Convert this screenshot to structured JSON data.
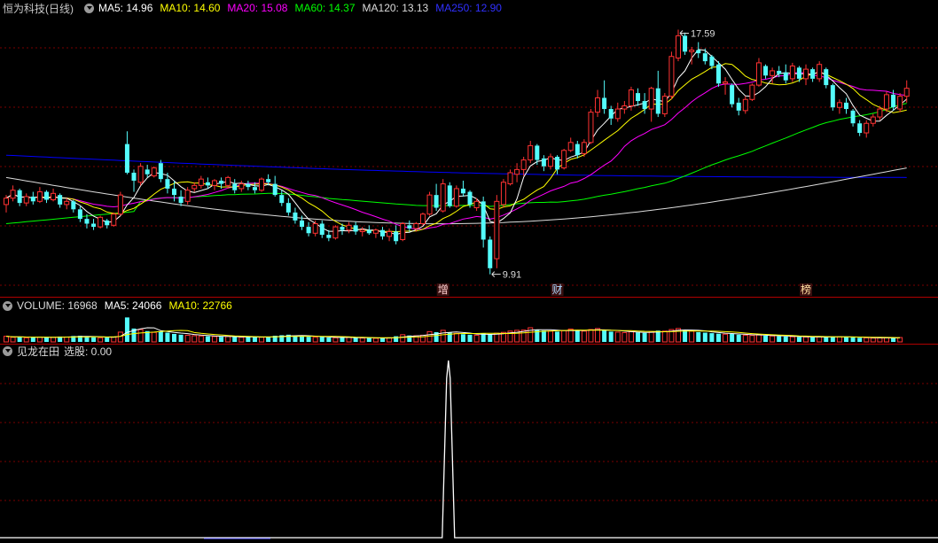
{
  "colors": {
    "up": "#ff3232",
    "down": "#54fcfc",
    "ma5": "#ffffff",
    "ma10": "#ffff00",
    "ma20": "#ff00ff",
    "ma60": "#00ff00",
    "ma120": "#dcdcdc",
    "ma250": "#0000ff",
    "grid": "#7a0000",
    "signal": "#ffffff"
  },
  "price_panel": {
    "title": "恒为科技(日线)",
    "ma5_label": "MA5: 14.96",
    "ma10_label": "MA10: 14.60",
    "ma20_label": "MA20: 15.08",
    "ma60_label": "MA60: 14.37",
    "ma120_label": "MA120: 13.13",
    "ma250_label": "MA250: 12.90",
    "high_label": "17.59",
    "low_label": "9.91",
    "markers": [
      {
        "text": "增",
        "index": 65
      },
      {
        "text": "财",
        "index": 82
      },
      {
        "text": "榜",
        "index": 119
      }
    ]
  },
  "volume_panel": {
    "volume_label": "VOLUME: 16968",
    "ma5_label": "MA5: 24066",
    "ma10_label": "MA10: 22766"
  },
  "signal_panel": {
    "title": "见龙在田",
    "value_label": "选股: 0.00"
  },
  "chart_data": [
    {
      "type": "candlestick",
      "title": "恒为科技(日线)",
      "y_range": [
        9.4,
        18.3
      ],
      "high_point": {
        "index": 100,
        "value": 17.59
      },
      "low_point": {
        "index": 72,
        "value": 9.91
      },
      "candles": [
        [
          12.1,
          12.4,
          11.85,
          12.3
        ],
        [
          12.3,
          12.7,
          12.2,
          12.55
        ],
        [
          12.55,
          12.6,
          12.05,
          12.15
        ],
        [
          12.15,
          12.45,
          12.05,
          12.35
        ],
        [
          12.35,
          12.5,
          12.1,
          12.2
        ],
        [
          12.2,
          12.65,
          12.15,
          12.5
        ],
        [
          12.5,
          12.55,
          12.15,
          12.25
        ],
        [
          12.25,
          12.6,
          12.2,
          12.45
        ],
        [
          12.4,
          12.45,
          12.0,
          12.1
        ],
        [
          12.1,
          12.3,
          11.95,
          12.2
        ],
        [
          12.2,
          12.25,
          11.85,
          11.95
        ],
        [
          11.95,
          12.05,
          11.55,
          11.65
        ],
        [
          11.65,
          11.8,
          11.35,
          11.5
        ],
        [
          11.5,
          11.65,
          11.3,
          11.4
        ],
        [
          11.4,
          11.75,
          11.35,
          11.7
        ],
        [
          11.6,
          11.65,
          11.35,
          11.45
        ],
        [
          11.45,
          11.85,
          11.4,
          11.8
        ],
        [
          11.8,
          12.5,
          11.75,
          12.4
        ],
        [
          14.0,
          14.4,
          13.05,
          13.1
        ],
        [
          13.1,
          13.2,
          12.5,
          12.85
        ],
        [
          12.8,
          13.4,
          12.7,
          13.3
        ],
        [
          13.2,
          13.35,
          12.95,
          13.05
        ],
        [
          13.0,
          13.3,
          12.95,
          13.25
        ],
        [
          13.4,
          13.5,
          12.8,
          12.9
        ],
        [
          12.9,
          13.1,
          12.45,
          12.6
        ],
        [
          12.6,
          12.85,
          12.2,
          12.4
        ],
        [
          12.35,
          12.55,
          12.05,
          12.15
        ],
        [
          12.2,
          12.65,
          12.1,
          12.55
        ],
        [
          12.6,
          12.8,
          12.5,
          12.7
        ],
        [
          12.7,
          13.0,
          12.6,
          12.9
        ],
        [
          12.8,
          12.95,
          12.6,
          12.7
        ],
        [
          12.7,
          12.9,
          12.55,
          12.85
        ],
        [
          12.85,
          12.95,
          12.6,
          12.75
        ],
        [
          12.7,
          13.0,
          12.6,
          12.95
        ],
        [
          12.75,
          12.9,
          12.45,
          12.55
        ],
        [
          12.6,
          12.85,
          12.5,
          12.75
        ],
        [
          12.75,
          12.85,
          12.55,
          12.65
        ],
        [
          12.65,
          12.8,
          12.45,
          12.55
        ],
        [
          12.55,
          12.95,
          12.5,
          12.9
        ],
        [
          12.9,
          13.05,
          12.7,
          12.8
        ],
        [
          12.75,
          13.0,
          12.35,
          12.4
        ],
        [
          12.4,
          12.55,
          12.05,
          12.15
        ],
        [
          12.15,
          12.3,
          11.75,
          11.85
        ],
        [
          11.85,
          12.0,
          11.5,
          11.6
        ],
        [
          11.6,
          11.75,
          11.3,
          11.4
        ],
        [
          11.4,
          11.55,
          11.1,
          11.2
        ],
        [
          11.2,
          11.6,
          11.1,
          11.5
        ],
        [
          11.5,
          11.6,
          11.05,
          11.15
        ],
        [
          11.15,
          11.3,
          10.95,
          11.05
        ],
        [
          11.05,
          11.45,
          11.0,
          11.4
        ],
        [
          11.4,
          11.5,
          11.15,
          11.3
        ],
        [
          11.3,
          11.55,
          11.2,
          11.45
        ],
        [
          11.45,
          11.55,
          11.15,
          11.25
        ],
        [
          11.25,
          11.4,
          11.1,
          11.3
        ],
        [
          11.3,
          11.45,
          11.15,
          11.2
        ],
        [
          11.2,
          11.35,
          11.05,
          11.3
        ],
        [
          11.3,
          11.4,
          11.0,
          11.1
        ],
        [
          11.1,
          11.35,
          10.95,
          11.25
        ],
        [
          11.25,
          11.45,
          10.85,
          10.95
        ],
        [
          11.0,
          11.55,
          10.95,
          11.5
        ],
        [
          11.45,
          11.6,
          11.25,
          11.35
        ],
        [
          11.35,
          11.55,
          11.25,
          11.5
        ],
        [
          11.5,
          11.85,
          11.45,
          11.8
        ],
        [
          11.8,
          12.5,
          11.75,
          12.4
        ],
        [
          12.4,
          12.75,
          11.9,
          12.0
        ],
        [
          11.9,
          12.9,
          11.85,
          12.75
        ],
        [
          12.7,
          12.8,
          12.0,
          12.05
        ],
        [
          12.05,
          12.7,
          12.0,
          12.6
        ],
        [
          12.6,
          12.85,
          12.35,
          12.45
        ],
        [
          12.5,
          12.55,
          12.0,
          12.1
        ],
        [
          12.0,
          12.3,
          11.9,
          12.2
        ],
        [
          12.2,
          12.35,
          10.75,
          11.0
        ],
        [
          11.0,
          11.1,
          9.91,
          10.1
        ],
        [
          10.4,
          12.4,
          10.1,
          12.2
        ],
        [
          12.1,
          12.9,
          12.0,
          12.8
        ],
        [
          12.75,
          13.2,
          12.7,
          13.1
        ],
        [
          13.05,
          13.4,
          12.8,
          13.2
        ],
        [
          13.2,
          13.6,
          13.0,
          13.5
        ],
        [
          13.5,
          14.1,
          13.4,
          13.95
        ],
        [
          13.95,
          14.0,
          13.35,
          13.5
        ],
        [
          13.55,
          13.65,
          13.15,
          13.3
        ],
        [
          13.3,
          13.7,
          13.2,
          13.6
        ],
        [
          13.6,
          13.65,
          13.05,
          13.2
        ],
        [
          13.25,
          13.85,
          13.2,
          13.8
        ],
        [
          13.8,
          14.2,
          13.75,
          14.05
        ],
        [
          14.0,
          14.1,
          13.55,
          13.65
        ],
        [
          13.7,
          14.15,
          13.6,
          14.05
        ],
        [
          14.05,
          15.1,
          14.0,
          15.0
        ],
        [
          15.0,
          15.7,
          14.85,
          15.45
        ],
        [
          15.45,
          16.0,
          14.95,
          15.1
        ],
        [
          15.1,
          15.2,
          14.6,
          14.8
        ],
        [
          14.8,
          15.3,
          14.7,
          15.1
        ],
        [
          15.1,
          15.35,
          14.95,
          15.2
        ],
        [
          15.2,
          15.8,
          15.05,
          15.7
        ],
        [
          15.6,
          15.75,
          15.2,
          15.35
        ],
        [
          15.35,
          15.6,
          14.95,
          15.1
        ],
        [
          15.1,
          15.8,
          14.7,
          15.75
        ],
        [
          15.75,
          16.3,
          14.85,
          14.95
        ],
        [
          14.95,
          15.6,
          14.85,
          15.5
        ],
        [
          15.5,
          16.9,
          15.4,
          16.75
        ],
        [
          16.7,
          17.59,
          16.6,
          17.4
        ],
        [
          17.4,
          17.5,
          16.8,
          16.9
        ],
        [
          16.9,
          17.05,
          16.5,
          16.95
        ],
        [
          16.95,
          17.2,
          16.7,
          16.85
        ],
        [
          16.85,
          17.0,
          16.5,
          16.6
        ],
        [
          16.75,
          16.8,
          16.35,
          16.45
        ],
        [
          16.5,
          16.6,
          15.8,
          15.9
        ],
        [
          15.9,
          16.1,
          15.55,
          15.95
        ],
        [
          15.85,
          15.9,
          15.15,
          15.25
        ],
        [
          15.3,
          15.45,
          14.9,
          15.05
        ],
        [
          15.05,
          15.5,
          14.95,
          15.4
        ],
        [
          15.4,
          15.9,
          15.35,
          15.85
        ],
        [
          15.85,
          16.7,
          15.8,
          16.55
        ],
        [
          16.45,
          16.5,
          16.05,
          16.15
        ],
        [
          16.15,
          16.4,
          15.9,
          16.3
        ],
        [
          16.3,
          16.45,
          16.1,
          16.2
        ],
        [
          16.25,
          16.5,
          15.9,
          16.0
        ],
        [
          16.05,
          16.55,
          15.95,
          16.45
        ],
        [
          16.4,
          16.45,
          15.95,
          16.05
        ],
        [
          16.05,
          16.5,
          15.85,
          16.35
        ],
        [
          16.35,
          16.4,
          15.95,
          16.05
        ],
        [
          16.05,
          16.6,
          15.95,
          16.5
        ],
        [
          16.35,
          16.4,
          15.75,
          15.85
        ],
        [
          15.85,
          15.9,
          15.05,
          15.15
        ],
        [
          15.15,
          15.4,
          14.95,
          15.3
        ],
        [
          15.3,
          15.45,
          14.95,
          15.1
        ],
        [
          15.05,
          15.1,
          14.55,
          14.65
        ],
        [
          14.65,
          14.75,
          14.25,
          14.35
        ],
        [
          14.35,
          14.75,
          14.2,
          14.65
        ],
        [
          14.65,
          14.95,
          14.55,
          14.85
        ],
        [
          14.85,
          15.2,
          14.75,
          15.1
        ],
        [
          15.1,
          15.65,
          15.0,
          15.55
        ],
        [
          15.55,
          15.7,
          15.05,
          15.15
        ],
        [
          15.1,
          15.6,
          15.0,
          15.5
        ],
        [
          15.5,
          16.0,
          15.3,
          15.75
        ]
      ]
    },
    {
      "type": "bar",
      "title": "VOLUME",
      "y_range": [
        0,
        110000
      ],
      "values": [
        22000,
        18000,
        20000,
        16000,
        17000,
        19000,
        17000,
        18000,
        21000,
        19000,
        23000,
        24000,
        20000,
        18000,
        16000,
        17000,
        19000,
        38000,
        95000,
        52000,
        48000,
        42000,
        37000,
        40000,
        36000,
        31000,
        28000,
        26000,
        24000,
        23000,
        22000,
        21000,
        20000,
        21000,
        19000,
        18000,
        19000,
        20000,
        18000,
        19000,
        24000,
        26000,
        28000,
        24000,
        22000,
        20000,
        18000,
        19000,
        17000,
        16000,
        17000,
        18000,
        16000,
        15000,
        16000,
        14000,
        15000,
        16000,
        22000,
        28000,
        25000,
        24000,
        26000,
        40000,
        38000,
        45000,
        36000,
        33000,
        30000,
        28000,
        26000,
        33000,
        29000,
        34000,
        37000,
        42000,
        45000,
        46000,
        55000,
        48000,
        44000,
        42000,
        40000,
        44000,
        50000,
        46000,
        42000,
        48000,
        52000,
        45000,
        40000,
        38000,
        36000,
        40000,
        37000,
        35000,
        39000,
        44000,
        42000,
        48000,
        52000,
        46000,
        42000,
        38000,
        36000,
        34000,
        32000,
        30000,
        31000,
        28000,
        26000,
        25000,
        27000,
        24000,
        23000,
        22000,
        21000,
        20000,
        19000,
        19000,
        18000,
        20000,
        19000,
        21000,
        20000,
        19000,
        17000,
        16000,
        16000,
        15000,
        15500,
        16000,
        15000,
        16968
      ]
    },
    {
      "type": "line",
      "title": "见龙在田",
      "y_range": [
        0,
        1
      ],
      "signal_index": 66,
      "value": 0.0
    }
  ]
}
